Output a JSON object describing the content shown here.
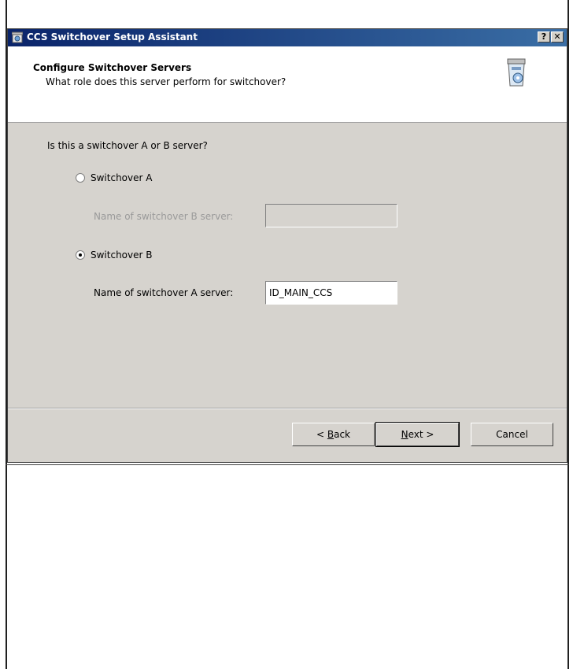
{
  "window": {
    "title": "CCS Switchover Setup Assistant",
    "help_label": "?",
    "close_label": "✕"
  },
  "header": {
    "title": "Configure Switchover Servers",
    "subtitle": "What role does this server perform for switchover?"
  },
  "form": {
    "question": "Is this a switchover A or B server?",
    "option_a": {
      "label": "Switchover A",
      "selected": false,
      "field_label": "Name of switchover B server:",
      "field_value": ""
    },
    "option_b": {
      "label": "Switchover B",
      "selected": true,
      "field_label": "Name of switchover A server:",
      "field_value": "ID_MAIN_CCS"
    }
  },
  "buttons": {
    "back": {
      "prefix": "< ",
      "mnemonic": "B",
      "rest": "ack"
    },
    "next": {
      "mnemonic": "N",
      "rest": "ext >"
    },
    "cancel": "Cancel"
  }
}
